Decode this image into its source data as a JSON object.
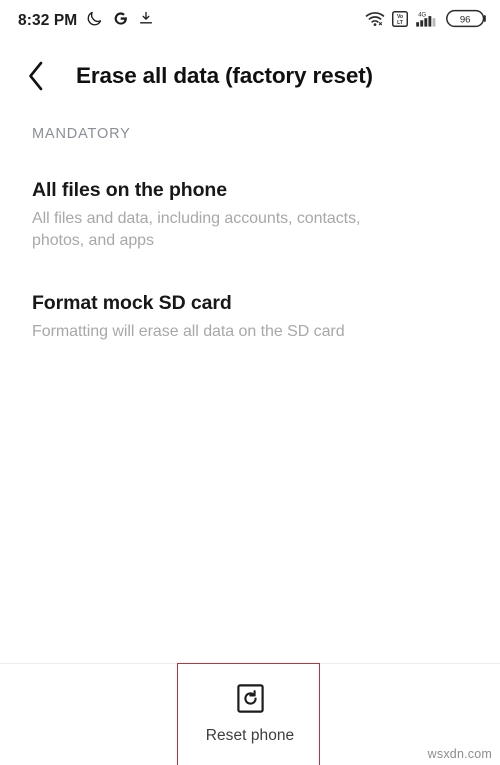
{
  "status_bar": {
    "time": "8:32 PM",
    "left_icons": [
      {
        "name": "do-not-disturb-moon-icon",
        "glyph": "moon"
      },
      {
        "name": "google-g-icon",
        "glyph": "G"
      },
      {
        "name": "download-icon",
        "glyph": "download"
      }
    ],
    "right_icons": [
      {
        "name": "wifi-icon",
        "glyph": "wifi"
      },
      {
        "name": "volte-icon",
        "glyph": "VoLTE"
      },
      {
        "name": "signal-4g-icon",
        "glyph": "4G",
        "label": "4G"
      }
    ],
    "battery_level": "96"
  },
  "header": {
    "back_label": "Back",
    "title": "Erase all data (factory reset)"
  },
  "content": {
    "section_label": "MANDATORY",
    "items": [
      {
        "title": "All files on the phone",
        "subtitle": "All files and data, including accounts, contacts, photos, and apps"
      },
      {
        "title": "Format mock SD card",
        "subtitle": "Formatting will erase all data on the SD card"
      }
    ]
  },
  "bottom_bar": {
    "reset_label": "Reset phone",
    "reset_icon": "restore-reset-icon"
  },
  "annotation": {
    "highlight_color": "#c0323f",
    "target": "reset-phone-button"
  },
  "watermark": "wsxdn.com",
  "colors": {
    "background": "#ffffff",
    "title_text": "#101010",
    "secondary_text": "#a8a8a8",
    "section_label": "#8a8f99",
    "divider": "#ececec"
  }
}
